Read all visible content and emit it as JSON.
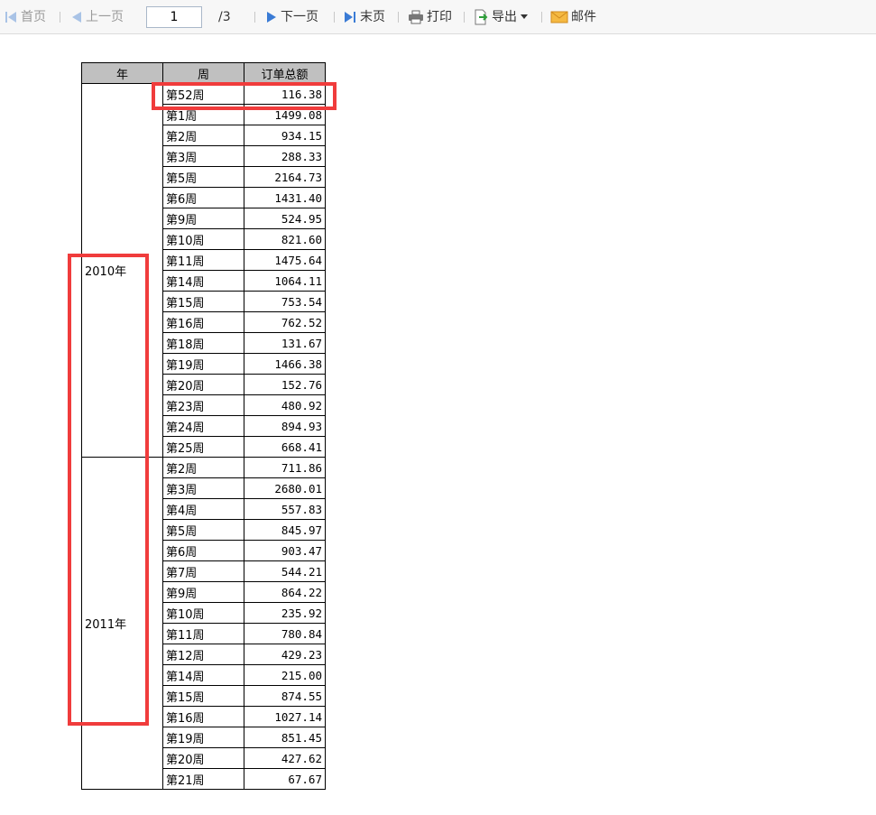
{
  "toolbar": {
    "first_label": "首页",
    "prev_label": "上一页",
    "page_value": "1",
    "total_pages": "/3",
    "next_label": "下一页",
    "last_label": "末页",
    "print_label": "打印",
    "export_label": "导出",
    "mail_label": "邮件"
  },
  "table": {
    "headers": [
      "年",
      "周",
      "订单总额"
    ],
    "groups": [
      {
        "year": "2010年",
        "rows": [
          [
            "第52周",
            "116.38"
          ],
          [
            "第1周",
            "1499.08"
          ],
          [
            "第2周",
            "934.15"
          ],
          [
            "第3周",
            "288.33"
          ],
          [
            "第5周",
            "2164.73"
          ],
          [
            "第6周",
            "1431.40"
          ],
          [
            "第9周",
            "524.95"
          ],
          [
            "第10周",
            "821.60"
          ],
          [
            "第11周",
            "1475.64"
          ],
          [
            "第14周",
            "1064.11"
          ],
          [
            "第15周",
            "753.54"
          ],
          [
            "第16周",
            "762.52"
          ],
          [
            "第18周",
            "131.67"
          ],
          [
            "第19周",
            "1466.38"
          ],
          [
            "第20周",
            "152.76"
          ],
          [
            "第23周",
            "480.92"
          ],
          [
            "第24周",
            "894.93"
          ],
          [
            "第25周",
            "668.41"
          ]
        ]
      },
      {
        "year": "2011年",
        "rows": [
          [
            "第2周",
            "711.86"
          ],
          [
            "第3周",
            "2680.01"
          ],
          [
            "第4周",
            "557.83"
          ],
          [
            "第5周",
            "845.97"
          ],
          [
            "第6周",
            "903.47"
          ],
          [
            "第7周",
            "544.21"
          ],
          [
            "第9周",
            "864.22"
          ],
          [
            "第10周",
            "235.92"
          ],
          [
            "第11周",
            "780.84"
          ],
          [
            "第12周",
            "429.23"
          ],
          [
            "第14周",
            "215.00"
          ],
          [
            "第15周",
            "874.55"
          ],
          [
            "第16周",
            "1027.14"
          ],
          [
            "第19周",
            "851.45"
          ],
          [
            "第20周",
            "427.62"
          ],
          [
            "第21周",
            "67.67"
          ]
        ]
      }
    ]
  },
  "colors": {
    "highlight": "#f03c3c",
    "header_bg": "#c0c0c0",
    "nav_blue": "#3a7bd5"
  }
}
